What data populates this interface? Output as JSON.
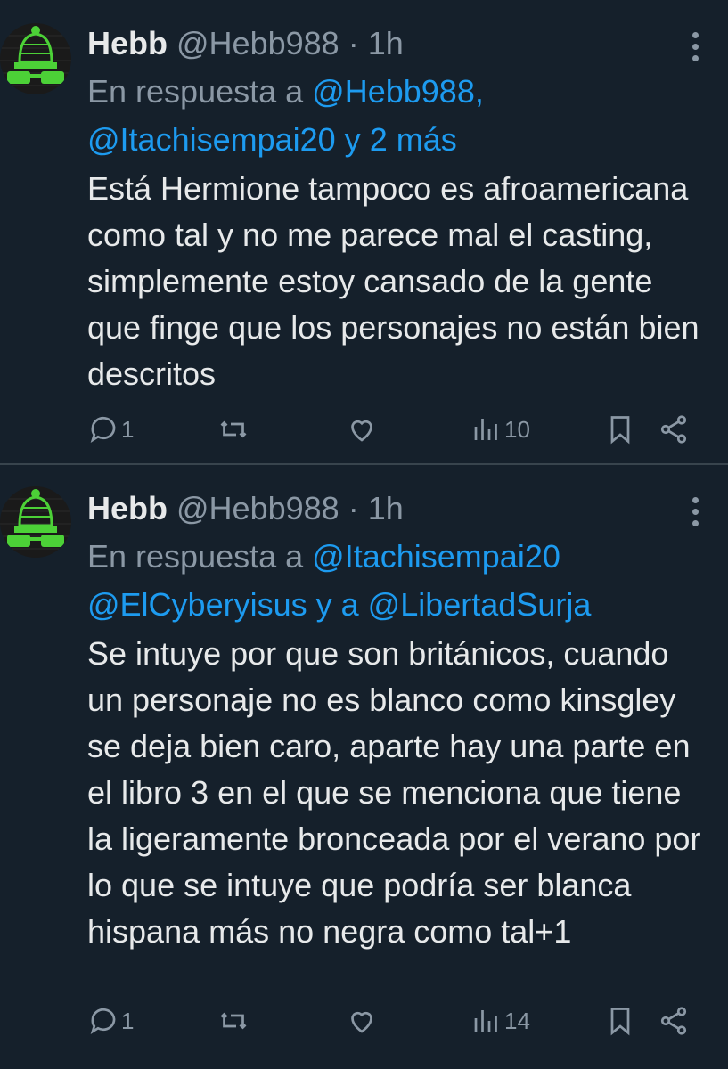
{
  "tweets": [
    {
      "name": "Hebb",
      "handle": "@Hebb988",
      "separator": "·",
      "time": "1h",
      "reply_prefix": "En respuesta a",
      "reply_line1": "@Hebb988,",
      "reply_line2": "@Itachisempai20 y 2 más",
      "text": "Está Hermione tampoco es afroamericana como tal y no me parece mal el casting, simplemente estoy cansado de la gente que finge que los personajes no están bien descritos",
      "replies": "1",
      "views": "10"
    },
    {
      "name": "Hebb",
      "handle": "@Hebb988",
      "separator": "·",
      "time": "1h",
      "reply_prefix": "En respuesta a",
      "reply_line1": "@Itachisempai20",
      "reply_line2a": "@ElCyberyisus",
      "reply_join": "y a",
      "reply_line2b": "@LibertadSurja",
      "text": "Se intuye por que son británicos, cuando un personaje no es blanco como kinsgley se deja bien caro, aparte hay una parte en el libro 3 en el que se menciona que tiene la ligeramente bronceada por el verano por lo que se intuye que podría ser blanca hispana más no negra como tal+1",
      "replies": "1",
      "views": "14"
    }
  ],
  "colors": {
    "background": "#15202b",
    "text": "#e7e9ea",
    "muted": "#8b98a5",
    "mention": "#1d9bf0",
    "divider": "#38444d",
    "avatar_accent": "#4cd137"
  },
  "icons": [
    "reply-icon",
    "retweet-icon",
    "like-icon",
    "views-icon",
    "bookmark-icon",
    "share-icon",
    "more-icon"
  ]
}
